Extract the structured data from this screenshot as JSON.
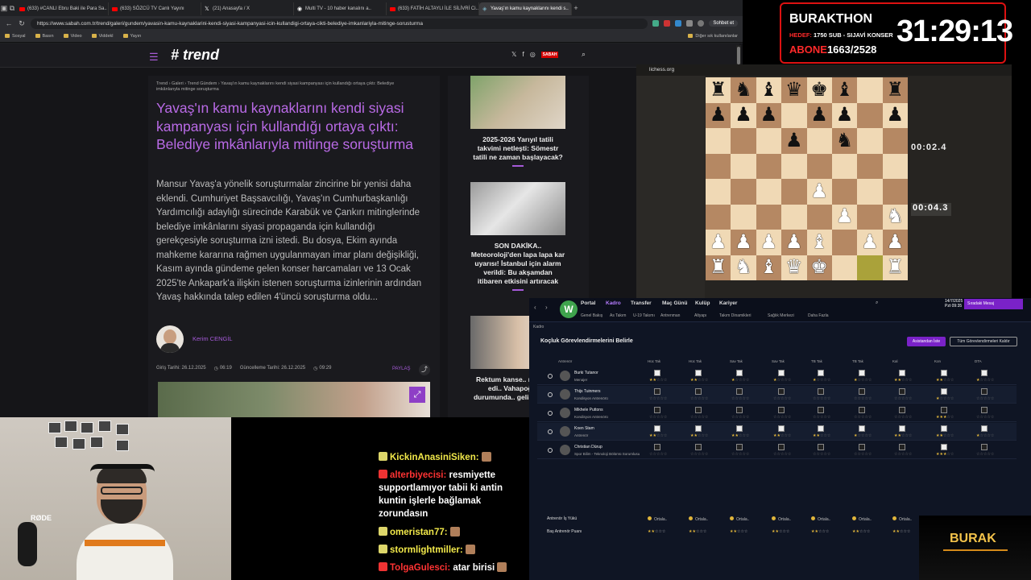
{
  "browser": {
    "tabs": [
      {
        "label": "(633) #CANLI Ebru Baki ile Para Sa..",
        "icon": "youtube-icon"
      },
      {
        "label": "(633) SÖZCÜ TV Canlı Yayını",
        "icon": "youtube-icon"
      },
      {
        "label": "(21) Anasayfa / X",
        "icon": "x-icon"
      },
      {
        "label": "Multi TV - 10 haber kanalını a..",
        "icon": "tv-icon"
      },
      {
        "label": "(633) FATİH ALTAYLI İLE SİLİVRİ Ci..",
        "icon": "youtube-icon"
      },
      {
        "label": "Yavaş'ın kamu kaynaklarını kendi s..",
        "icon": "sabah-icon",
        "active": true
      }
    ],
    "url": "https://www.sabah.com.tr/trend/galeri/gundem/yavasin-kamu-kaynaklarini-kendi-siyasi-kampanyasi-icin-kullandigi-ortaya-cikti-belediye-imkanlariyla-mitinge-sorusturma",
    "copilot": "Sohbet et",
    "bookmarks": [
      "Sosyal",
      "Basın",
      "Video",
      "Viddekl",
      "Yayın"
    ],
    "other_bookmarks": "Diğer sık kullanılanlar"
  },
  "site": {
    "logo": "# trend",
    "newspaper": "SABAH",
    "breadcrumb": "Trend  ›  Galeri  ›  Trend Gündem  ›  Yavaş'ın kamu kaynaklarını kendi siyasi kampanyası için kullandığı ortaya çıktı: Belediye imkânlarıyla mitinge soruşturma",
    "title": "Yavaş'ın kamu kaynaklarını kendi siyasi kampanyası için kullandığı ortaya çıktı: Belediye imkânlarıyla mitinge soruşturma",
    "body": "Mansur Yavaş'a yönelik soruşturmalar zincirine bir yenisi daha eklendi. Cumhuriyet Başsavcılığı, Yavaş'ın Cumhurbaşkanlığı Yardımcılığı adaylığı sürecinde Karabük ve Çankırı mitinglerinde belediye imkânlarını siyasi propaganda için kullandığı gerekçesiyle soruşturma izni istedi. Bu dosya, Ekim ayında mahkeme kararına rağmen uygulanmayan imar planı değişikliği, Kasım ayında gündeme gelen konser harcamaları ve 13 Ocak 2025'te Ankapark'a ilişkin istenen soruşturma izinlerinin ardından Yavaş hakkında talep edilen 4'üncü soruşturma oldu...",
    "author": "Kerim CENGİL",
    "created_label": "Giriş Tarihi: 26.12.2025",
    "created_time": "06:19",
    "updated_label": "Güncelleme Tarihi: 26.12.2025",
    "updated_time": "09:29",
    "share": "PAYLAŞ",
    "sidebar": [
      {
        "caption": "2025-2026 Yarıyıl tatili takvimi netleşti: Sömestr tatili ne zaman başlayacak?"
      },
      {
        "caption": "SON DAKİKA.. Meteoroloji'den lapa lapa kar uyarısı! İstanbul için alarm verildi: Bu akşamdan itibaren etkisini artıracak"
      },
      {
        "caption": "Rektum kanse.. mücadele edi.. Vahapoğlu s.. durumunda.. gelişmeyi du.."
      }
    ]
  },
  "overlay": {
    "name": "BURAKTHON",
    "hedef_label": "HEDEF:",
    "hedef": "1750 SUB - SIJAVİ KONSER",
    "abone_label": "ABONE",
    "abone": "1663/2528",
    "timer": "31:29:13"
  },
  "chess": {
    "site": "lichess.org",
    "clock_top": "00:02.4",
    "clock_bottom": "00:04.3"
  },
  "fm": {
    "nav": [
      "Portal",
      "Kadro",
      "Transfer",
      "Maç Günü",
      "Kulüp",
      "Kariyer"
    ],
    "subnav": [
      "Genel Bakış",
      "As Takım",
      "U-19 Takımı",
      "Antrenman",
      "Altyapı",
      "Takım Dinamikleri",
      "Sağlık Merkezi",
      "Daha Fazla"
    ],
    "date": "14/7/2025",
    "day": "Pzt  09:35",
    "message": "Sıradaki Mesaj",
    "breadcrumb": "Kadro",
    "title": "Koçluk Görevlendirmelerini Belirle",
    "btn_primary": "Asistandan İste",
    "btn_secondary": "Tüm Görevlendirmeleri Kaldır",
    "columns": [
      "Antrenör",
      "Hüc Tak",
      "Hüc Tak",
      "Sav Tak",
      "Sav Tak",
      "TB Tak",
      "TB Tak",
      "Kal",
      "Kon",
      "DTA"
    ],
    "staff": [
      {
        "name": "Burki Tutanor",
        "role": "Menajer"
      },
      {
        "name": "Thijs Tuinmers",
        "role": "Kondisyon Antrenörü"
      },
      {
        "name": "Mikhele Puttons",
        "role": "Kondisyon Antrenörü"
      },
      {
        "name": "Koen Stam",
        "role": "Antrenör"
      },
      {
        "name": "Christian Dürup",
        "role": "Spor Bilim - Teknoloji Bölümü Sorumlusu"
      }
    ],
    "workload_label": "Antrenör İş Yükü",
    "workload_value": "Ortala..",
    "score_label": "Baş Antrenör Puanı",
    "brand": "BURAK"
  },
  "chat": [
    {
      "user": "KickinAnasiniSiken:",
      "msg": "",
      "color": "yellow"
    },
    {
      "user": "alterbiyecisi:",
      "msg": "resmiyette supportlamıyor tabii ki antin kuntin işlerle bağlamak zorundasın",
      "color": "red"
    },
    {
      "user": "omeristan77:",
      "msg": "",
      "color": "yellow"
    },
    {
      "user": "stormlightmiller:",
      "msg": "",
      "color": "yellow"
    },
    {
      "user": "TolgaGulesci:",
      "msg": "atar birisi",
      "color": "red"
    }
  ]
}
